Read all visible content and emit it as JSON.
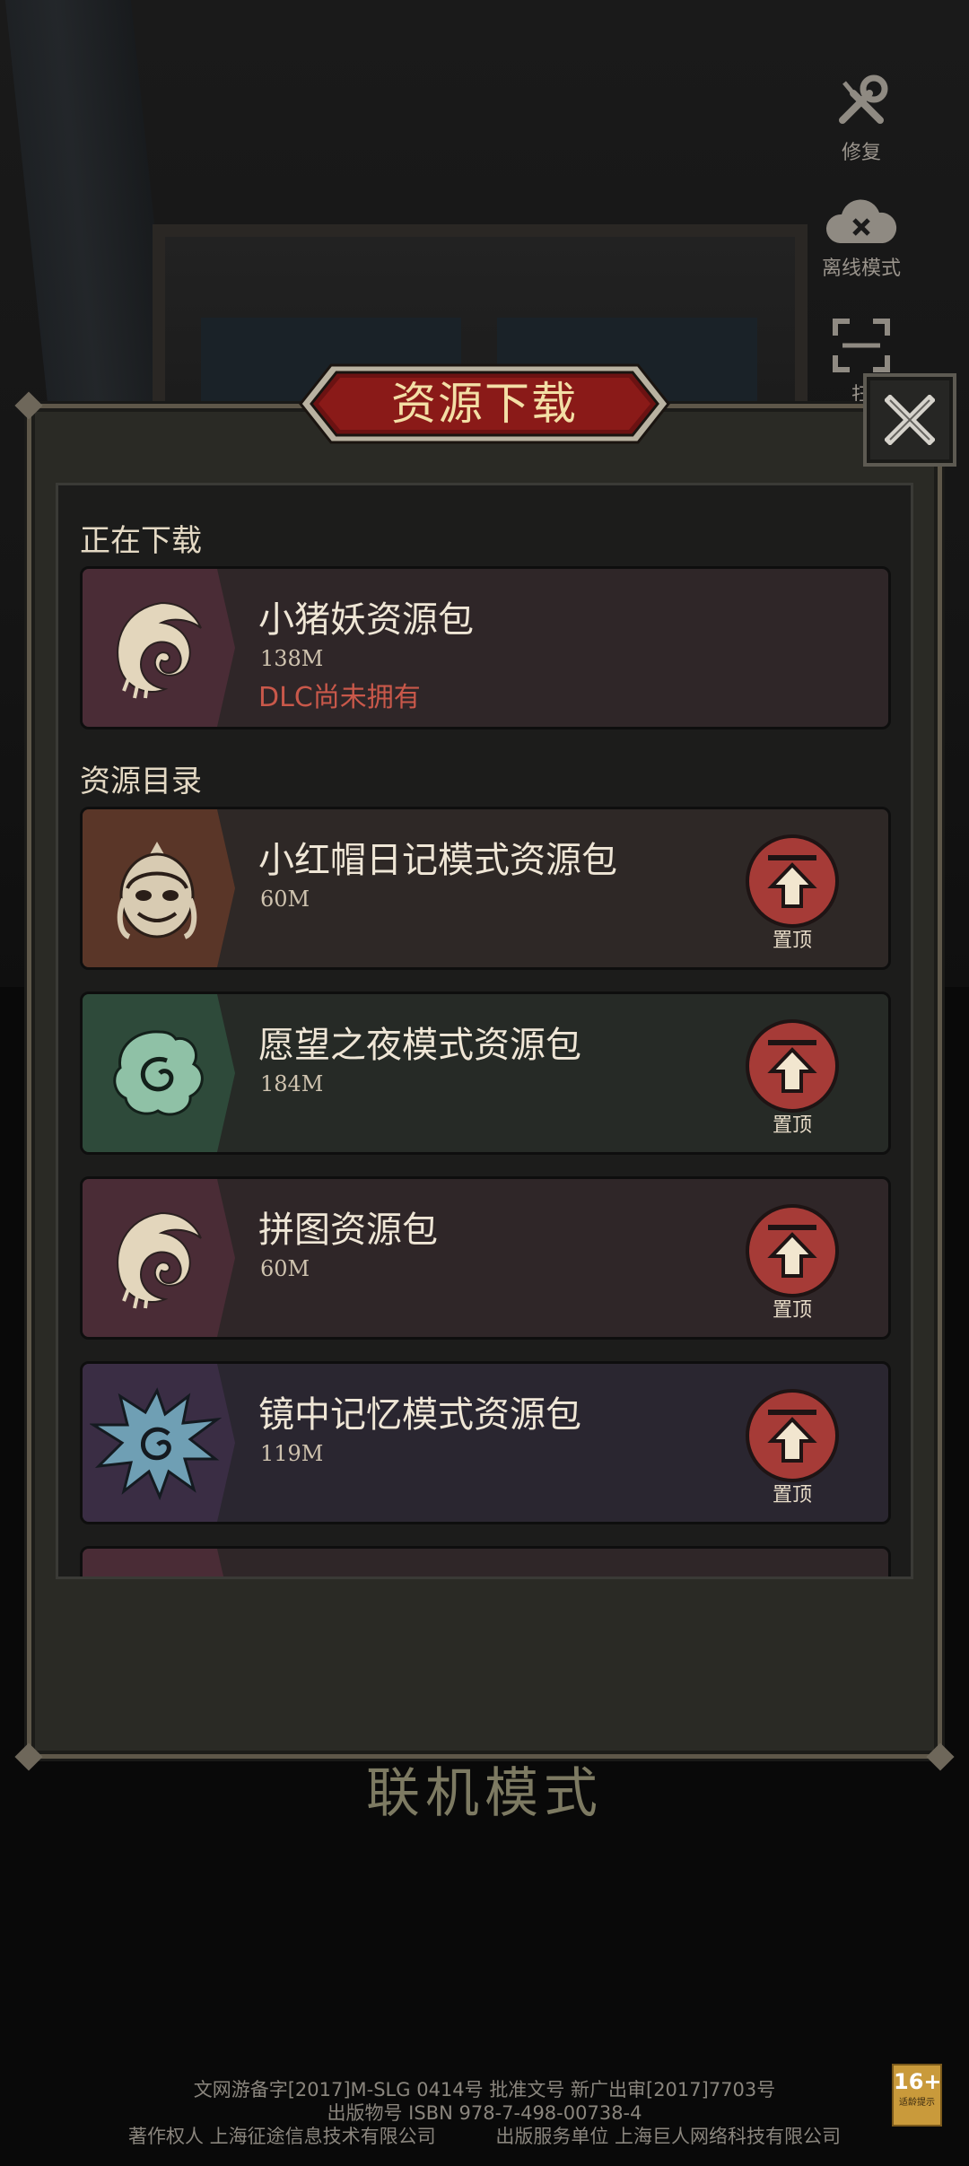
{
  "background": {
    "side_buttons": [
      {
        "label": "修复",
        "icon": "wrench-screwdriver-icon"
      },
      {
        "label": "离线模式",
        "icon": "cloud-offline-icon"
      },
      {
        "label": "扫",
        "icon": "scan-icon"
      }
    ],
    "mode_text": "联机模式"
  },
  "dialog": {
    "title": "资源下载",
    "close_icon": "close-icon",
    "downloading_section": {
      "label": "正在下载",
      "items": [
        {
          "title": "小猪妖资源包",
          "size": "138M",
          "status": "DLC尚未拥有",
          "icon": "moon-spiral-icon",
          "theme": "#4a2c36"
        }
      ]
    },
    "catalog_section": {
      "label": "资源目录",
      "items": [
        {
          "title": "小红帽日记模式资源包",
          "size": "60M",
          "pin_label": "置顶",
          "icon": "witch-face-icon",
          "theme": "#5a3628"
        },
        {
          "title": "愿望之夜模式资源包",
          "size": "184M",
          "pin_label": "置顶",
          "icon": "leaf-spiral-icon",
          "theme": "#2e4a3a"
        },
        {
          "title": "拼图资源包",
          "size": "60M",
          "pin_label": "置顶",
          "icon": "moon-spiral-icon",
          "theme": "#4a2c36"
        },
        {
          "title": "镜中记忆模式资源包",
          "size": "119M",
          "pin_label": "置顶",
          "icon": "spiky-spiral-icon",
          "theme": "#3a2d44"
        }
      ]
    }
  },
  "footer": {
    "line1": "文网游备字[2017]M-SLG 0414号 批准文号 新广出审[2017]7703号",
    "line2": "出版物号 ISBN 978-7-498-00738-4",
    "line3_left": "著作权人 上海征途信息技术有限公司",
    "line3_right": "出版服务单位 上海巨人网络科技有限公司",
    "age_rating": "16+",
    "age_note": "适龄提示"
  }
}
